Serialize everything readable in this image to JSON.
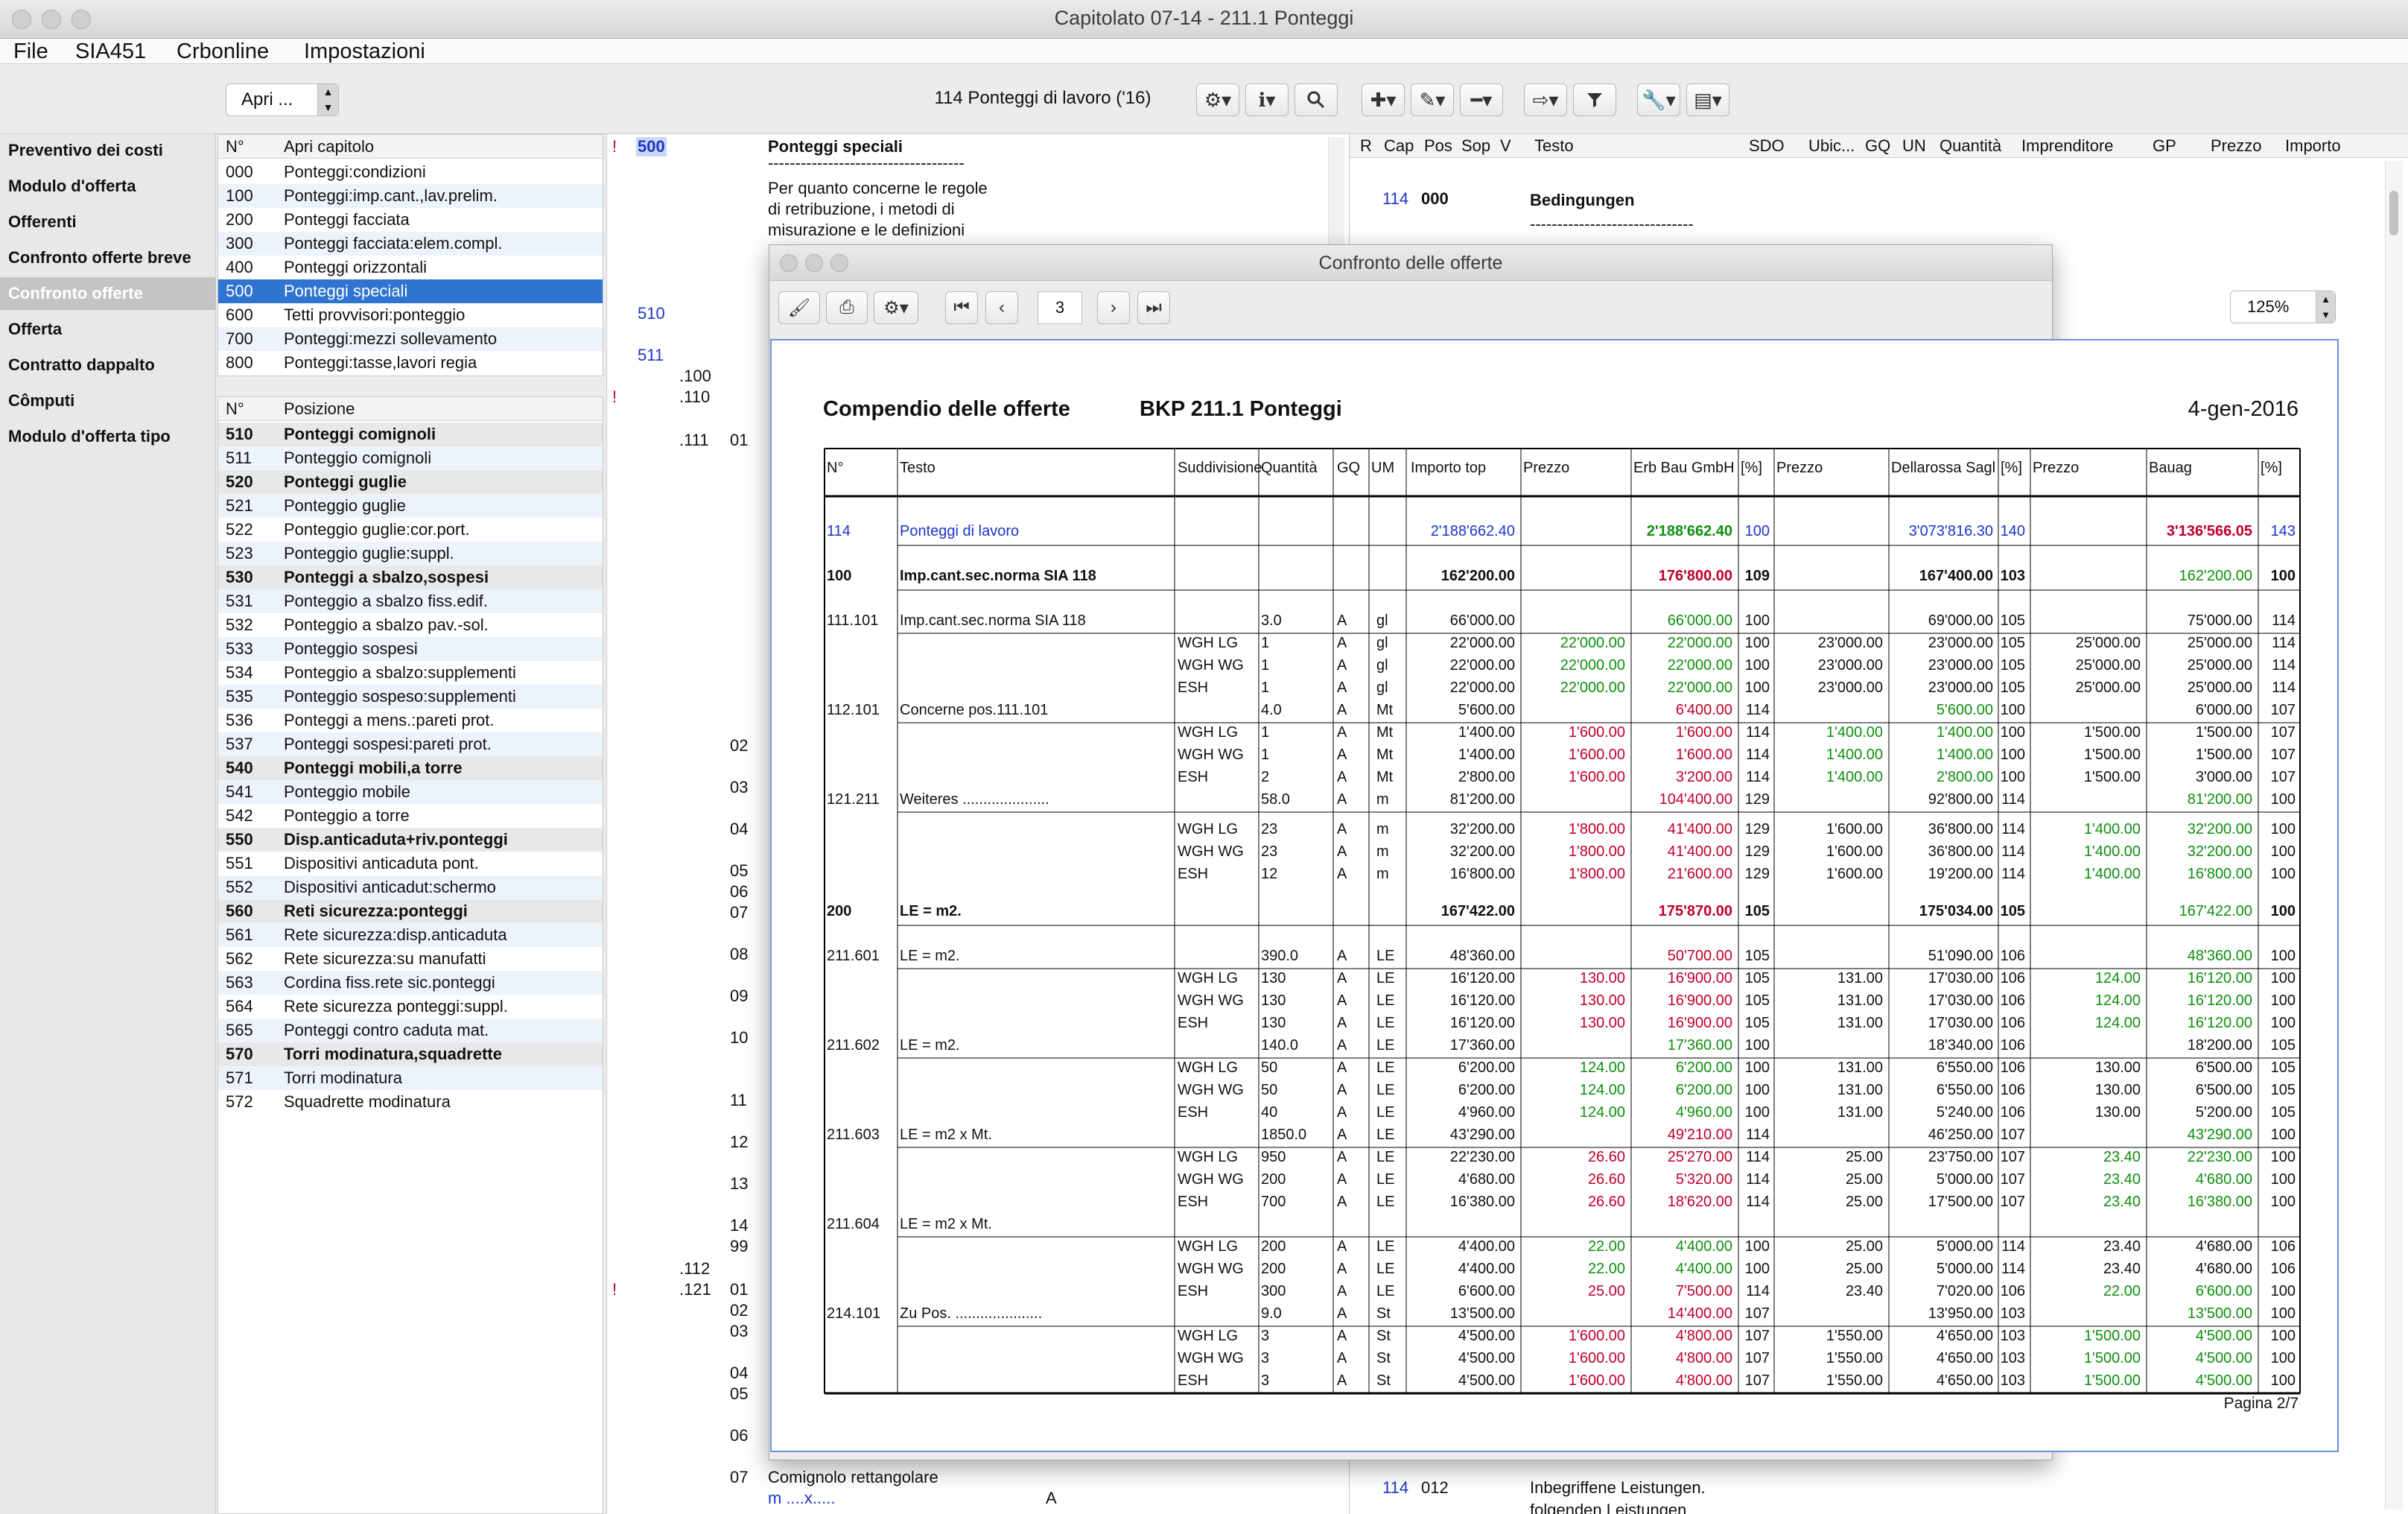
{
  "window": {
    "title": "Capitolato 07-14 - 211.1 Ponteggi"
  },
  "menu": [
    "File",
    "SIA451",
    "Crbonline",
    "Impostazioni"
  ],
  "toolbar": {
    "open_label": "Apri ...",
    "chapter_label": "114 Ponteggi di lavoro ('16)"
  },
  "nav": [
    {
      "label": "Preventivo dei costi",
      "selected": false
    },
    {
      "label": "Modulo d'offerta",
      "selected": false
    },
    {
      "label": "Offerenti",
      "selected": false
    },
    {
      "label": "Confronto offerte breve",
      "selected": false
    },
    {
      "label": "Confronto offerte",
      "selected": true
    },
    {
      "label": "Offerta",
      "selected": false
    },
    {
      "label": "Contratto dappalto",
      "selected": false
    },
    {
      "label": "Cômputi",
      "selected": false
    },
    {
      "label": "Modulo d'offerta tipo",
      "selected": false
    }
  ],
  "chapters": {
    "header_no": "N°",
    "header_title": "Apri capitolo",
    "rows": [
      {
        "no": "000",
        "title": "Ponteggi:condizioni"
      },
      {
        "no": "100",
        "title": "Ponteggi:imp.cant.,lav.prelim."
      },
      {
        "no": "200",
        "title": "Ponteggi facciata"
      },
      {
        "no": "300",
        "title": "Ponteggi facciata:elem.compl."
      },
      {
        "no": "400",
        "title": "Ponteggi orizzontali"
      },
      {
        "no": "500",
        "title": "Ponteggi speciali",
        "selected": true
      },
      {
        "no": "600",
        "title": "Tetti provvisori:ponteggio"
      },
      {
        "no": "700",
        "title": "Ponteggi:mezzi sollevamento"
      },
      {
        "no": "800",
        "title": "Ponteggi:tasse,lavori regia"
      }
    ]
  },
  "positions": {
    "header_no": "N°",
    "header_title": "Posizione",
    "rows": [
      {
        "no": "510",
        "title": "Ponteggi comignoli",
        "bold": true
      },
      {
        "no": "511",
        "title": "Ponteggio comignoli"
      },
      {
        "no": "520",
        "title": "Ponteggi guglie",
        "bold": true
      },
      {
        "no": "521",
        "title": "Ponteggio guglie"
      },
      {
        "no": "522",
        "title": "Ponteggio guglie:cor.port."
      },
      {
        "no": "523",
        "title": "Ponteggio guglie:suppl."
      },
      {
        "no": "530",
        "title": "Ponteggi a sbalzo,sospesi",
        "bold": true
      },
      {
        "no": "531",
        "title": "Ponteggio a sbalzo fiss.edif."
      },
      {
        "no": "532",
        "title": "Ponteggio a sbalzo pav.-sol."
      },
      {
        "no": "533",
        "title": "Ponteggio sospesi"
      },
      {
        "no": "534",
        "title": "Ponteggio a sbalzo:supplementi"
      },
      {
        "no": "535",
        "title": "Ponteggio sospeso:supplementi"
      },
      {
        "no": "536",
        "title": "Ponteggi a mens.:pareti prot."
      },
      {
        "no": "537",
        "title": "Ponteggi sospesi:pareti prot."
      },
      {
        "no": "540",
        "title": "Ponteggi mobili,a torre",
        "bold": true
      },
      {
        "no": "541",
        "title": "Ponteggio mobile"
      },
      {
        "no": "542",
        "title": "Ponteggio a torre"
      },
      {
        "no": "550",
        "title": "Disp.anticaduta+riv.ponteggi",
        "bold": true
      },
      {
        "no": "551",
        "title": "Dispositivi anticaduta pont."
      },
      {
        "no": "552",
        "title": "Dispositivi anticadut:schermo"
      },
      {
        "no": "560",
        "title": "Reti sicurezza:ponteggi",
        "bold": true
      },
      {
        "no": "561",
        "title": "Rete sicurezza:disp.anticaduta"
      },
      {
        "no": "562",
        "title": "Rete sicurezza:su manufatti"
      },
      {
        "no": "563",
        "title": "Cordina fiss.rete sic.ponteggi"
      },
      {
        "no": "564",
        "title": "Rete sicurezza ponteggi:suppl."
      },
      {
        "no": "565",
        "title": "Ponteggi contro caduta mat."
      },
      {
        "no": "570",
        "title": "Torri modinatura,squadrette",
        "bold": true
      },
      {
        "no": "571",
        "title": "Torri modinatura"
      },
      {
        "no": "572",
        "title": "Squadrette modinatura"
      }
    ]
  },
  "middle": {
    "heading_no": "500",
    "heading_title": "Ponteggi speciali",
    "heading_rule": "------------------------------------",
    "text_lines": [
      "Per quanto concerne le regole",
      "di retribuzione, i metodi di",
      "misurazione e le definizioni"
    ],
    "markers": [
      "!",
      "!",
      "!"
    ],
    "left_codes": [
      "510",
      "511"
    ],
    "sub_codes": [
      ".100",
      ".110",
      ".111",
      ".112",
      ".121"
    ],
    "sub_nums": [
      "01",
      "02",
      "03",
      "04",
      "05",
      "06",
      "07",
      "08",
      "09",
      "10",
      "11",
      "12",
      "13",
      "14",
      "99",
      "01",
      "02",
      "03",
      "04",
      "05",
      "06",
      "07"
    ],
    "bottom_lines": [
      "Comignolo rettangolare",
      "m ....x....."
    ],
    "bottom_mark": "A"
  },
  "right_table": {
    "headers": [
      "R",
      "Cap",
      "Pos",
      "Sop",
      "V",
      "Testo",
      "SDO",
      "Ubic...",
      "GQ",
      "UN",
      "Quantità",
      "Imprenditore",
      "GP",
      "Prezzo",
      "Importo"
    ],
    "row1": {
      "cap": "114",
      "pos": "000",
      "text": "Bedingungen",
      "rule": "------------------------------"
    },
    "row2": {
      "cap": "114",
      "pos": "012",
      "text": "Inbegriffene Leistungen.",
      "text2": "folgenden Leistungen"
    }
  },
  "modal": {
    "title": "Confronto delle offerte",
    "page": "3",
    "zoom": "125%"
  },
  "report": {
    "title": "Compendio delle offerte",
    "bkp": "BKP 211.1 Ponteggi",
    "date": "4-gen-2016",
    "columns": [
      "N°",
      "Testo",
      "Suddivisione",
      "Quantità",
      "GQ",
      "UM",
      "Importo top",
      "Prezzo",
      "Erb Bau GmbH",
      "[%]",
      "Prezzo",
      "Dellarossa Sagl",
      "[%]",
      "Prezzo",
      "Bauag",
      "[%]"
    ],
    "footer": "Pagina 2/7",
    "rows": [
      {
        "no": "114",
        "text": "Ponteggi di lavoro",
        "top": "2'188'662.40",
        "erb": "2'188'662.40",
        "erbp": "100",
        "del": "3'073'816.30",
        "delp": "140",
        "bau": "3'136'566.05",
        "baup": "143",
        "style": "chapter"
      },
      {
        "no": "100",
        "text": "Imp.cant.sec.norma SIA 118",
        "top": "162'200.00",
        "erb": "176'800.00",
        "erbp": "109",
        "del": "167'400.00",
        "delp": "103",
        "bau": "162'200.00",
        "baup": "100",
        "style": "group"
      },
      {
        "no": "111.101",
        "text": "Imp.cant.sec.norma SIA 118",
        "qty": "3.0",
        "gq": "A",
        "um": "gl",
        "top": "66'000.00",
        "erb": "66'000.00",
        "erbp": "100",
        "del": "69'000.00",
        "delp": "105",
        "bau": "75'000.00",
        "baup": "114",
        "style": "pos"
      },
      {
        "sub": "WGH LG",
        "qty": "1",
        "gq": "A",
        "um": "gl",
        "top": "22'000.00",
        "p1": "22'000.00",
        "erb": "22'000.00",
        "erbp": "100",
        "p2": "23'000.00",
        "del": "23'000.00",
        "delp": "105",
        "p3": "25'000.00",
        "bau": "25'000.00",
        "baup": "114",
        "style": "sub"
      },
      {
        "sub": "WGH WG",
        "qty": "1",
        "gq": "A",
        "um": "gl",
        "top": "22'000.00",
        "p1": "22'000.00",
        "erb": "22'000.00",
        "erbp": "100",
        "p2": "23'000.00",
        "del": "23'000.00",
        "delp": "105",
        "p3": "25'000.00",
        "bau": "25'000.00",
        "baup": "114",
        "style": "sub"
      },
      {
        "sub": "ESH",
        "qty": "1",
        "gq": "A",
        "um": "gl",
        "top": "22'000.00",
        "p1": "22'000.00",
        "erb": "22'000.00",
        "erbp": "100",
        "p2": "23'000.00",
        "del": "23'000.00",
        "delp": "105",
        "p3": "25'000.00",
        "bau": "25'000.00",
        "baup": "114",
        "style": "sub"
      },
      {
        "no": "112.101",
        "text": "Concerne pos.111.101",
        "qty": "4.0",
        "gq": "A",
        "um": "Mt",
        "top": "5'600.00",
        "erb": "6'400.00",
        "erbp": "114",
        "del": "5'600.00",
        "delp": "100",
        "bau": "6'000.00",
        "baup": "107",
        "style": "pos"
      },
      {
        "sub": "WGH LG",
        "qty": "1",
        "gq": "A",
        "um": "Mt",
        "top": "1'400.00",
        "p1": "1'600.00",
        "erb": "1'600.00",
        "erbp": "114",
        "p2": "1'400.00",
        "del": "1'400.00",
        "delp": "100",
        "p3": "1'500.00",
        "bau": "1'500.00",
        "baup": "107",
        "style": "sub"
      },
      {
        "sub": "WGH WG",
        "qty": "1",
        "gq": "A",
        "um": "Mt",
        "top": "1'400.00",
        "p1": "1'600.00",
        "erb": "1'600.00",
        "erbp": "114",
        "p2": "1'400.00",
        "del": "1'400.00",
        "delp": "100",
        "p3": "1'500.00",
        "bau": "1'500.00",
        "baup": "107",
        "style": "sub"
      },
      {
        "sub": "ESH",
        "qty": "2",
        "gq": "A",
        "um": "Mt",
        "top": "2'800.00",
        "p1": "1'600.00",
        "erb": "3'200.00",
        "erbp": "114",
        "p2": "1'400.00",
        "del": "2'800.00",
        "delp": "100",
        "p3": "1'500.00",
        "bau": "3'000.00",
        "baup": "107",
        "style": "sub"
      },
      {
        "no": "121.211",
        "text": "Weiteres .....................",
        "qty": "58.0",
        "gq": "A",
        "um": "m",
        "top": "81'200.00",
        "erb": "104'400.00",
        "erbp": "129",
        "del": "92'800.00",
        "delp": "114",
        "bau": "81'200.00",
        "baup": "100",
        "style": "pos"
      },
      {
        "sub": "WGH LG",
        "qty": "23",
        "gq": "A",
        "um": "m",
        "top": "32'200.00",
        "p1": "1'800.00",
        "erb": "41'400.00",
        "erbp": "129",
        "p2": "1'600.00",
        "del": "36'800.00",
        "delp": "114",
        "p3": "1'400.00",
        "bau": "32'200.00",
        "baup": "100",
        "style": "sub"
      },
      {
        "sub": "WGH WG",
        "qty": "23",
        "gq": "A",
        "um": "m",
        "top": "32'200.00",
        "p1": "1'800.00",
        "erb": "41'400.00",
        "erbp": "129",
        "p2": "1'600.00",
        "del": "36'800.00",
        "delp": "114",
        "p3": "1'400.00",
        "bau": "32'200.00",
        "baup": "100",
        "style": "sub"
      },
      {
        "sub": "ESH",
        "qty": "12",
        "gq": "A",
        "um": "m",
        "top": "16'800.00",
        "p1": "1'800.00",
        "erb": "21'600.00",
        "erbp": "129",
        "p2": "1'600.00",
        "del": "19'200.00",
        "delp": "114",
        "p3": "1'400.00",
        "bau": "16'800.00",
        "baup": "100",
        "style": "sub"
      },
      {
        "no": "200",
        "text": "LE = m2.",
        "top": "167'422.00",
        "erb": "175'870.00",
        "erbp": "105",
        "del": "175'034.00",
        "delp": "105",
        "bau": "167'422.00",
        "baup": "100",
        "style": "group"
      },
      {
        "no": "211.601",
        "text": "LE = m2.",
        "qty": "390.0",
        "gq": "A",
        "um": "LE",
        "top": "48'360.00",
        "erb": "50'700.00",
        "erbp": "105",
        "del": "51'090.00",
        "delp": "106",
        "bau": "48'360.00",
        "baup": "100",
        "style": "pos"
      },
      {
        "sub": "WGH LG",
        "qty": "130",
        "gq": "A",
        "um": "LE",
        "top": "16'120.00",
        "p1": "130.00",
        "erb": "16'900.00",
        "erbp": "105",
        "p2": "131.00",
        "del": "17'030.00",
        "delp": "106",
        "p3": "124.00",
        "bau": "16'120.00",
        "baup": "100",
        "style": "sub"
      },
      {
        "sub": "WGH WG",
        "qty": "130",
        "gq": "A",
        "um": "LE",
        "top": "16'120.00",
        "p1": "130.00",
        "erb": "16'900.00",
        "erbp": "105",
        "p2": "131.00",
        "del": "17'030.00",
        "delp": "106",
        "p3": "124.00",
        "bau": "16'120.00",
        "baup": "100",
        "style": "sub"
      },
      {
        "sub": "ESH",
        "qty": "130",
        "gq": "A",
        "um": "LE",
        "top": "16'120.00",
        "p1": "130.00",
        "erb": "16'900.00",
        "erbp": "105",
        "p2": "131.00",
        "del": "17'030.00",
        "delp": "106",
        "p3": "124.00",
        "bau": "16'120.00",
        "baup": "100",
        "style": "sub"
      },
      {
        "no": "211.602",
        "text": "LE = m2.",
        "qty": "140.0",
        "gq": "A",
        "um": "LE",
        "top": "17'360.00",
        "erb": "17'360.00",
        "erbp": "100",
        "del": "18'340.00",
        "delp": "106",
        "bau": "18'200.00",
        "baup": "105",
        "style": "pos"
      },
      {
        "sub": "WGH LG",
        "qty": "50",
        "gq": "A",
        "um": "LE",
        "top": "6'200.00",
        "p1": "124.00",
        "erb": "6'200.00",
        "erbp": "100",
        "p2": "131.00",
        "del": "6'550.00",
        "delp": "106",
        "p3": "130.00",
        "bau": "6'500.00",
        "baup": "105",
        "style": "sub"
      },
      {
        "sub": "WGH WG",
        "qty": "50",
        "gq": "A",
        "um": "LE",
        "top": "6'200.00",
        "p1": "124.00",
        "erb": "6'200.00",
        "erbp": "100",
        "p2": "131.00",
        "del": "6'550.00",
        "delp": "106",
        "p3": "130.00",
        "bau": "6'500.00",
        "baup": "105",
        "style": "sub"
      },
      {
        "sub": "ESH",
        "qty": "40",
        "gq": "A",
        "um": "LE",
        "top": "4'960.00",
        "p1": "124.00",
        "erb": "4'960.00",
        "erbp": "100",
        "p2": "131.00",
        "del": "5'240.00",
        "delp": "106",
        "p3": "130.00",
        "bau": "5'200.00",
        "baup": "105",
        "style": "sub"
      },
      {
        "no": "211.603",
        "text": "LE = m2 x Mt.",
        "qty": "1850.0",
        "gq": "A",
        "um": "LE",
        "top": "43'290.00",
        "erb": "49'210.00",
        "erbp": "114",
        "del": "46'250.00",
        "delp": "107",
        "bau": "43'290.00",
        "baup": "100",
        "style": "pos"
      },
      {
        "sub": "WGH LG",
        "qty": "950",
        "gq": "A",
        "um": "LE",
        "top": "22'230.00",
        "p1": "26.60",
        "erb": "25'270.00",
        "erbp": "114",
        "p2": "25.00",
        "del": "23'750.00",
        "delp": "107",
        "p3": "23.40",
        "bau": "22'230.00",
        "baup": "100",
        "style": "sub"
      },
      {
        "sub": "WGH WG",
        "qty": "200",
        "gq": "A",
        "um": "LE",
        "top": "4'680.00",
        "p1": "26.60",
        "erb": "5'320.00",
        "erbp": "114",
        "p2": "25.00",
        "del": "5'000.00",
        "delp": "107",
        "p3": "23.40",
        "bau": "4'680.00",
        "baup": "100",
        "style": "sub"
      },
      {
        "sub": "ESH",
        "qty": "700",
        "gq": "A",
        "um": "LE",
        "top": "16'380.00",
        "p1": "26.60",
        "erb": "18'620.00",
        "erbp": "114",
        "p2": "25.00",
        "del": "17'500.00",
        "delp": "107",
        "p3": "23.40",
        "bau": "16'380.00",
        "baup": "100",
        "style": "sub"
      },
      {
        "no": "211.604",
        "text": "LE = m2 x Mt.",
        "style": "posnum"
      },
      {
        "sub": "WGH LG",
        "qty": "200",
        "gq": "A",
        "um": "LE",
        "top": "4'400.00",
        "p1": "22.00",
        "erb": "4'400.00",
        "erbp": "100",
        "p2": "25.00",
        "del": "5'000.00",
        "delp": "114",
        "p3": "23.40",
        "bau": "4'680.00",
        "baup": "106",
        "style": "sub"
      },
      {
        "sub": "WGH WG",
        "qty": "200",
        "gq": "A",
        "um": "LE",
        "top": "4'400.00",
        "p1": "22.00",
        "erb": "4'400.00",
        "erbp": "100",
        "p2": "25.00",
        "del": "5'000.00",
        "delp": "114",
        "p3": "23.40",
        "bau": "4'680.00",
        "baup": "106",
        "style": "sub"
      },
      {
        "sub": "ESH",
        "qty": "300",
        "gq": "A",
        "um": "LE",
        "top": "6'600.00",
        "p1": "25.00",
        "erb": "7'500.00",
        "erbp": "114",
        "p2": "23.40",
        "del": "7'020.00",
        "delp": "106",
        "p3": "22.00",
        "bau": "6'600.00",
        "baup": "100",
        "style": "sub"
      },
      {
        "no": "214.101",
        "text": "Zu Pos. .....................",
        "qty": "9.0",
        "gq": "A",
        "um": "St",
        "top": "13'500.00",
        "erb": "14'400.00",
        "erbp": "107",
        "del": "13'950.00",
        "delp": "103",
        "bau": "13'500.00",
        "baup": "100",
        "style": "pos"
      },
      {
        "sub": "WGH LG",
        "qty": "3",
        "gq": "A",
        "um": "St",
        "top": "4'500.00",
        "p1": "1'600.00",
        "erb": "4'800.00",
        "erbp": "107",
        "p2": "1'550.00",
        "del": "4'650.00",
        "delp": "103",
        "p3": "1'500.00",
        "bau": "4'500.00",
        "baup": "100",
        "style": "sub"
      },
      {
        "sub": "WGH WG",
        "qty": "3",
        "gq": "A",
        "um": "St",
        "top": "4'500.00",
        "p1": "1'600.00",
        "erb": "4'800.00",
        "erbp": "107",
        "p2": "1'550.00",
        "del": "4'650.00",
        "delp": "103",
        "p3": "1'500.00",
        "bau": "4'500.00",
        "baup": "100",
        "style": "sub"
      },
      {
        "sub": "ESH",
        "qty": "3",
        "gq": "A",
        "um": "St",
        "top": "4'500.00",
        "p1": "1'600.00",
        "erb": "4'800.00",
        "erbp": "107",
        "p2": "1'550.00",
        "del": "4'650.00",
        "delp": "103",
        "p3": "1'500.00",
        "bau": "4'500.00",
        "baup": "100",
        "style": "sub"
      }
    ]
  },
  "colors": {
    "green": "#0e8f0e",
    "red": "#c0002c",
    "blue": "#1b35c9",
    "select": "#2f74d0"
  }
}
